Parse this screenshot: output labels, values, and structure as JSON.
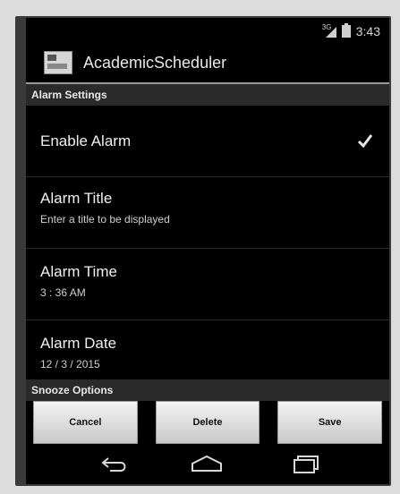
{
  "status_bar": {
    "network_badge": "3G",
    "time": "3:43"
  },
  "action_bar": {
    "title": "AcademicScheduler"
  },
  "sections": {
    "alarm_settings": "Alarm Settings",
    "snooze_options": "Snooze Options"
  },
  "preferences": {
    "enable_alarm": {
      "title": "Enable Alarm",
      "checked": true
    },
    "alarm_title": {
      "title": "Alarm Title",
      "summary": "Enter a title to be displayed"
    },
    "alarm_time": {
      "title": "Alarm Time",
      "summary": "3 : 36 AM"
    },
    "alarm_date": {
      "title": "Alarm Date",
      "summary": "12 / 3 / 2015"
    }
  },
  "buttons": {
    "cancel": "Cancel",
    "delete": "Delete",
    "save": "Save"
  },
  "icons": {
    "signal": "signal-icon",
    "battery": "battery-icon",
    "app": "app-icon",
    "check": "check-icon",
    "back": "back-icon",
    "home": "home-icon",
    "recent_apps": "recent-apps-icon"
  }
}
